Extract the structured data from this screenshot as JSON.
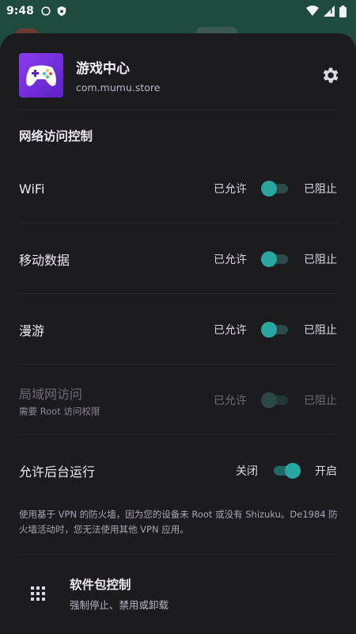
{
  "statusbar": {
    "time": "9:48"
  },
  "app": {
    "name": "游戏中心",
    "package": "com.mumu.store"
  },
  "network": {
    "section_title": "网络访问控制",
    "rows": [
      {
        "label": "WiFi",
        "sublabel": "",
        "left_option": "已允许",
        "right_option": "已阻止",
        "state": "allowed",
        "disabled": false
      },
      {
        "label": "移动数据",
        "sublabel": "",
        "left_option": "已允许",
        "right_option": "已阻止",
        "state": "allowed",
        "disabled": false
      },
      {
        "label": "漫游",
        "sublabel": "",
        "left_option": "已允许",
        "right_option": "已阻止",
        "state": "allowed",
        "disabled": false
      },
      {
        "label": "局域网访问",
        "sublabel": "需要 Root 访问权限",
        "left_option": "已允许",
        "right_option": "已阻止",
        "state": "allowed",
        "disabled": true
      }
    ]
  },
  "background": {
    "label": "允许后台运行",
    "left_option": "关闭",
    "right_option": "开启",
    "state": "on"
  },
  "note": "使用基于 VPN 的防火墙，因为您的设备未 Root 或没有 Shizuku。De1984 防火墙活动时，您无法使用其他 VPN 应用。",
  "package_control": {
    "title": "软件包控制",
    "subtitle": "强制停止、禁用或卸载"
  },
  "colors": {
    "accent": "#2aa6a0",
    "sheet_bg": "#1c1b1f",
    "app_icon": "#7a32e6"
  },
  "icons": {
    "settings": "gear-icon",
    "package_control": "grid-icon"
  }
}
